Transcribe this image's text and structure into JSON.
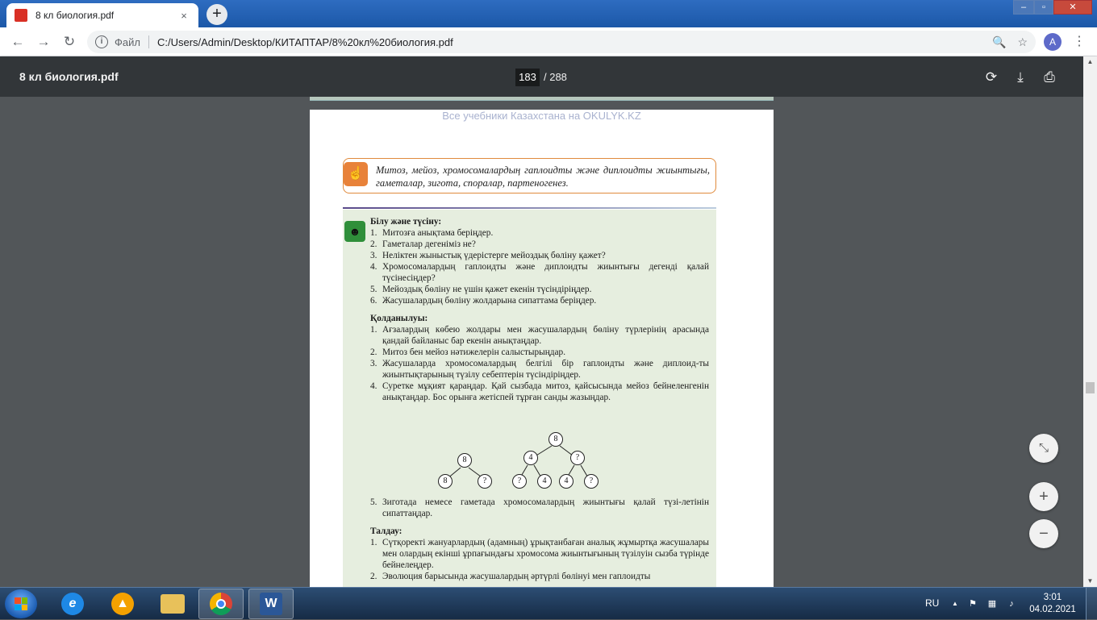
{
  "browser": {
    "tab_title": "8 кл биология.pdf",
    "tab_close": "×",
    "new_tab": "+",
    "window_min": "–",
    "window_max": "▫",
    "window_close": "✕",
    "nav_back": "←",
    "nav_forward": "→",
    "nav_reload": "↻",
    "scheme_label": "Файл",
    "url": "C:/Users/Admin/Desktop/КИТАПТАР/8%20кл%20биология.pdf",
    "zoom_glyph": "🔍",
    "star_glyph": "☆",
    "avatar_letter": "A",
    "menu_glyph": "⋮"
  },
  "pdf_toolbar": {
    "title": "8 кл биология.pdf",
    "current_page": "183",
    "page_total": "/ 288",
    "rotate_glyph": "⟳",
    "download_glyph": "⤓",
    "print_glyph": "⎙"
  },
  "page": {
    "watermark": "Все учебники Казахстана на OKULYK.KZ",
    "keywords": "Митоз, мейоз, хромосомалардың гаплоидты және диплоидты жиынтығы, гаметалар, зигота, споралар, партеногенез.",
    "section1_title": "Білу және түсіну:",
    "section1_items": [
      {
        "n": "1.",
        "t": "Митозға анықтама беріңдер."
      },
      {
        "n": "2.",
        "t": "Гаметалар дегеніміз не?"
      },
      {
        "n": "3.",
        "t": "Неліктен жыныстық үдерістерге мейоздық бөліну қажет?"
      },
      {
        "n": "4.",
        "t": "Хромосомалардың гаплоидты және диплоидты жиынтығы дегенді қалай түсінесіңдер?"
      },
      {
        "n": "5.",
        "t": "Мейоздық бөліну не үшін қажет екенін түсіндіріңдер."
      },
      {
        "n": "6.",
        "t": "Жасушалардың бөліну жолдарына сипаттама беріңдер."
      }
    ],
    "section2_title": "Қолданылуы:",
    "section2_items": [
      {
        "n": "1.",
        "t": "Ағзалардың көбею жолдары мен жасушалардың бөліну түрлерінің арасында қандай байланыс бар екенін анықтаңдар."
      },
      {
        "n": "2.",
        "t": "Митоз бен мейоз нәтижелерін салыстырыңдар."
      },
      {
        "n": "3.",
        "t": "Жасушаларда хромосомалардың белгілі бір гаплоидты және диплоид-ты жиынтықтарының түзілу себептерін түсіндіріңдер."
      },
      {
        "n": "4.",
        "t": "Суретке мұқият қараңдар. Қай сызбада митоз, қайсысында мейоз бейнеленгенін анықтаңдар. Бос орынға жетіспей тұрған санды жазыңдар."
      }
    ],
    "diagram_small": {
      "root": "8",
      "left": "8",
      "right": "?"
    },
    "diagram_big": {
      "root": "8",
      "l1": "4",
      "r1": "?",
      "ll": "?",
      "lr": "4",
      "rl": "4",
      "rr": "?"
    },
    "section2_item5": {
      "n": "5.",
      "t": "Зиготада немесе гаметада хромосомалардың жиынтығы қалай түзі-летінін сипаттаңдар."
    },
    "section3_title": "Талдау:",
    "section3_items": [
      {
        "n": "1.",
        "t": "Сүтқоректі жануарлардың (адамның) ұрықтанбаған аналық жұмыртқа жасушалары мен олардың екінші ұрпағындағы хромосома жиынтығының түзілуін сызба түрінде бейнелеңдер."
      },
      {
        "n": "2.",
        "t": "Эволюция барысында жасушалардың әртүрлі бөлінуі мен гаплоидты"
      }
    ]
  },
  "zoom_controls": {
    "fit": "⤡",
    "plus": "+",
    "minus": "−"
  },
  "taskbar": {
    "lang": "RU",
    "time": "3:01",
    "date": "04.02.2021",
    "tray_up": "▲",
    "ie_glyph": "e",
    "word_glyph": "W"
  },
  "colors": {
    "accent_orange": "#e08a3c",
    "green_panel": "#e6eedf",
    "pdf_toolbar": "#323639",
    "viewer_bg": "#525659"
  }
}
